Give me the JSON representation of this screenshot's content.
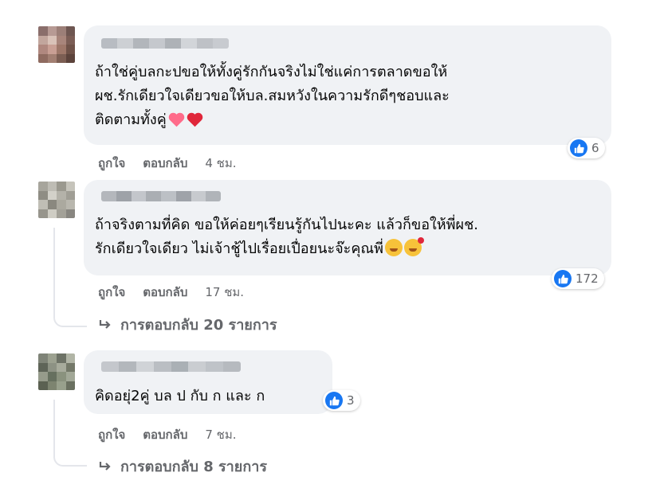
{
  "comments": [
    {
      "avatar_colors": [
        "#8a6e6b",
        "#b79a94",
        "#9c7f78",
        "#6e5651",
        "#c2a69d",
        "#d9c2b8",
        "#a8857b",
        "#7b5d55",
        "#b0887f",
        "#c99f94",
        "#9e7769",
        "#6f5248",
        "#8f6b60",
        "#a27f72",
        "#7c5e53",
        "#5c433b"
      ],
      "author_colors": [
        "#b8bcc2",
        "#cdd0d4",
        "#b2b6bb",
        "#c5c8cd",
        "#aeb2b7",
        "#d2d5d9",
        "#bec1c6",
        "#c8cbd0"
      ],
      "lines": [
        "ถ้าใช่คู่บลกะปขอให้ทั้งคู่รักกันจริงไม่ใช่แค่การตลาดขอให้",
        "ผช.รักเดียวใจเดียวขอให้บล.สมหวังในความรักดีๆชอบและ",
        "ติดตามทั้งคู่"
      ],
      "emojis": [
        "two-hearts-icon",
        "red-heart-icon"
      ],
      "reaction_icon": "like-icon",
      "reaction_count": "6",
      "like_label": "ถูกใจ",
      "reply_label": "ตอบกลับ",
      "time": "4 ชม."
    },
    {
      "avatar_colors": [
        "#a7a59c",
        "#bebcb4",
        "#9b998f",
        "#c6c4bb",
        "#8f8d84",
        "#d3d1c9",
        "#b4b2a9",
        "#a09e95",
        "#c0beb5",
        "#8a887f",
        "#aba99f",
        "#b9b7ae",
        "#97958c",
        "#cfcdc4",
        "#a3a198",
        "#888680"
      ],
      "author_colors": [
        "#b4b7bc",
        "#9ea2a8",
        "#c3c6cb",
        "#aaaeb3",
        "#bcc0c5",
        "#9fa3a9",
        "#c7cace",
        "#b0b4b9"
      ],
      "lines": [
        "ถ้าจริงตามที่คิด ขอให้ค่อยๆเรียนรู้กันไปนะคะ แล้วก็ขอให้พี่ผช.",
        "รักเดียวใจเดียว ไม่เจ้าชู้ไปเรื่อยเปื่อยนะจ๊ะคุณพี่"
      ],
      "emojis": [
        "grinning-face-icon",
        "smiling-face-with-hearts-icon"
      ],
      "reaction_icon": "like-icon",
      "reaction_count": "172",
      "like_label": "ถูกใจ",
      "reply_label": "ตอบกลับ",
      "time": "17 ชม.",
      "view_replies": "การตอบกลับ 20 รายการ"
    },
    {
      "avatar_colors": [
        "#7f8478",
        "#9ca190",
        "#6d7266",
        "#b1b5a6",
        "#5e6458",
        "#8d9284",
        "#a7ab9c",
        "#737868",
        "#969b8b",
        "#66705f",
        "#8a927e",
        "#a2a897",
        "#5b6152",
        "#7d8470",
        "#98a08c",
        "#6a7060"
      ],
      "author_colors": [
        "#c4c7cc",
        "#b3b7bc",
        "#d0d3d7",
        "#babec3",
        "#aab0b5",
        "#cacdd1",
        "#bfc3c8",
        "#b6babf"
      ],
      "lines": [
        "คิดอยุ่2คู่ บล ป กับ ก และ ก"
      ],
      "reaction_icon": "like-icon",
      "reaction_count": "3",
      "like_label": "ถูกใจ",
      "reply_label": "ตอบกลับ",
      "time": "7 ชม.",
      "view_replies": "การตอบกลับ 8 รายการ"
    }
  ],
  "colors": {
    "bubble": "#f0f2f5",
    "meta_text": "#65676b",
    "like_blue": "#1877f2",
    "thread_line": "#e4e6eb"
  }
}
